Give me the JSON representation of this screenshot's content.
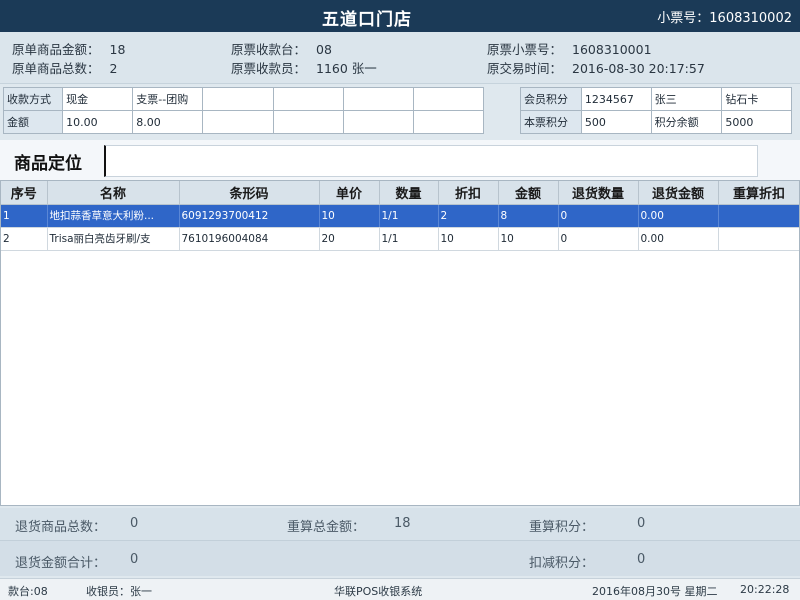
{
  "header": {
    "store_name": "五道口门店",
    "ticket_label": "小票号：",
    "ticket_no": "1608310002"
  },
  "orig": {
    "amount_label": "原单商品金额：",
    "amount": "18",
    "count_label": "原单商品总数：",
    "count": "2",
    "register_label": "原票收款台：",
    "register": "08",
    "cashier_label": "原票收款员：",
    "cashier": "1160 张一",
    "ticket_label": "原票小票号：",
    "ticket": "1608310001",
    "time_label": "原交易时间：",
    "time": "2016-08-30 20:17:57"
  },
  "payment": {
    "method_label": "收款方式",
    "amount_label": "金额",
    "methods": [
      "现金",
      "支票--团购",
      "",
      "",
      "",
      ""
    ],
    "amounts": [
      "10.00",
      "8.00",
      "",
      "",
      "",
      ""
    ]
  },
  "member": {
    "points_label": "会员积分",
    "member_no": "1234567",
    "name": "张三",
    "level": "钻石卡",
    "ticket_points_label": "本票积分",
    "ticket_points": "500",
    "balance_label": "积分余额",
    "balance": "5000"
  },
  "locate": {
    "label": "商品定位",
    "value": ""
  },
  "table": {
    "headers": [
      "序号",
      "名称",
      "条形码",
      "单价",
      "数量",
      "折扣",
      "金额",
      "退货数量",
      "退货金额",
      "重算折扣"
    ],
    "rows": [
      [
        "1",
        "地扣蒜香草意大利粉...",
        "6091293700412",
        "10",
        "1/1",
        "2",
        "8",
        "0",
        "0.00",
        ""
      ],
      [
        "2",
        "Trisa丽白亮齿牙刷/支",
        "7610196004084",
        "20",
        "1/1",
        "10",
        "10",
        "0",
        "0.00",
        ""
      ]
    ]
  },
  "summary": {
    "return_count_label": "退货商品总数：",
    "return_count": "0",
    "recalc_total_label": "重算总金额：",
    "recalc_total": "18",
    "recalc_points_label": "重算积分：",
    "recalc_points": "0",
    "return_amount_label": "退货金额合计：",
    "return_amount": "0",
    "deduct_points_label": "扣减积分：",
    "deduct_points": "0"
  },
  "status": {
    "register": "款台:08",
    "cashier": "收银员：张一",
    "system": "华联POS收银系统",
    "date": "2016年08月30号 星期二",
    "time": "20:22:28"
  }
}
